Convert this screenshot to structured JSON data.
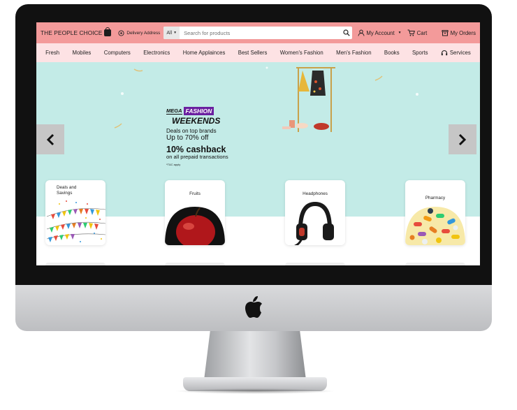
{
  "header": {
    "brand": "THE PEOPLE CHOICE",
    "delivery": "Delivery Address",
    "search_category": "All",
    "search_placeholder": "Search for products",
    "account": "My Account",
    "cart": "Cart",
    "orders": "My Orders"
  },
  "nav": {
    "items": [
      "Fresh",
      "Mobiles",
      "Computers",
      "Electronics",
      "Home Applainces",
      "Best Sellers",
      "Women's Fashion",
      "Men's Fashion",
      "Books",
      "Sports"
    ],
    "services": "Services"
  },
  "banner": {
    "mega": "MEGA",
    "fashion": "FASHION",
    "weekends": "WEEKENDS",
    "deals": "Deals on top brands",
    "upto": "Up to 70% off",
    "cashback": "10% cashback",
    "prepaid": "on all prepaid transactions",
    "tnc": "*T&C apply"
  },
  "cards": [
    {
      "label": "Deals and Savings"
    },
    {
      "label": "Fruits"
    },
    {
      "label": "Headphones"
    },
    {
      "label": "Pharmacy"
    }
  ],
  "colors": {
    "topbar": "#f39a9a",
    "navbar": "#fde2e4",
    "hero": "#c3ebe7"
  }
}
